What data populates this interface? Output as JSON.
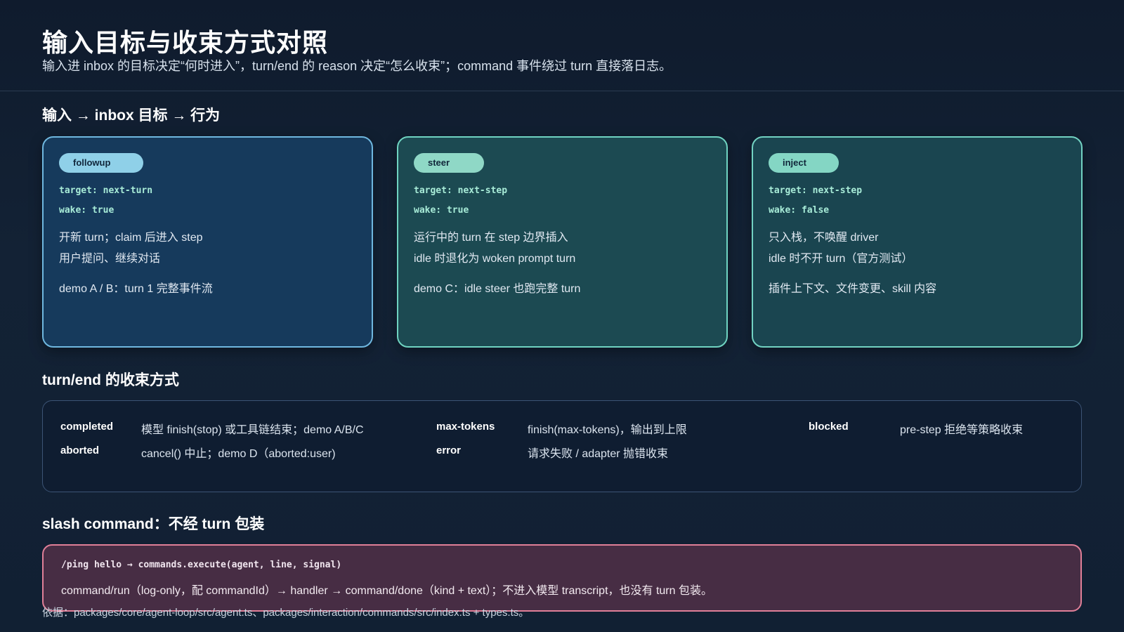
{
  "header": {
    "title": "输入目标与收束方式对照",
    "subtitle": "输入进 inbox 的目标决定“何时进入”，turn/end 的 reason 决定“怎么收束”；command 事件绕过 turn 直接落日志。"
  },
  "sections": {
    "inputs_title": "输入 → inbox 目标 → 行为",
    "turn_end_title": "turn/end 的收束方式",
    "slash_title": "slash command：不经 turn 包装"
  },
  "cards": [
    {
      "tag": "followup",
      "target": "target: next-turn",
      "wake": "wake: true",
      "line1": "开新 turn；claim 后进入 step",
      "line2": "用户提问、继续对话",
      "note": "demo A / B：turn 1 完整事件流"
    },
    {
      "tag": "steer",
      "target": "target: next-step",
      "wake": "wake: true",
      "line1": "运行中的 turn 在 step 边界插入",
      "line2": "idle 时退化为 woken prompt turn",
      "note": "demo C：idle steer 也跑完整 turn"
    },
    {
      "tag": "inject",
      "target": "target: next-step",
      "wake": "wake: false",
      "line1": "只入栈，不唤醒 driver",
      "line2": "idle 时不开 turn（官方测试）",
      "note": "插件上下文、文件变更、skill 内容"
    }
  ],
  "turn_end": [
    {
      "key": "completed",
      "value": "模型 finish(stop) 或工具链结束；demo A/B/C"
    },
    {
      "key": "max-tokens",
      "value": "finish(max-tokens)，输出到上限"
    },
    {
      "key": "blocked",
      "value": "pre-step 拒绝等策略收束"
    },
    {
      "key": "aborted",
      "value": "cancel() 中止；demo D（aborted:user)"
    },
    {
      "key": "error",
      "value": "请求失败 / adapter 抛错收束"
    }
  ],
  "command": {
    "code": "/ping hello → commands.execute(agent, line, signal)",
    "desc": "command/run（log-only，配 commandId）→ handler → command/done（kind + text）；不进入模型 transcript，也没有 turn 包装。"
  },
  "footnote": "依据：packages/core/agent-loop/src/agent.ts、packages/interaction/commands/src/index.ts + types.ts。",
  "colors": {
    "background": "#0f1b2d",
    "followup_border": "#6fb7df",
    "steer_border": "#6fd3c1",
    "inject_border": "#72d2c2",
    "command_border": "#e07f98"
  }
}
